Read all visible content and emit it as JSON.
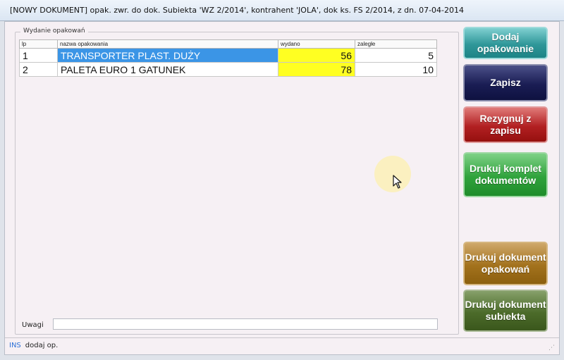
{
  "window": {
    "title": "[NOWY DOKUMENT] opak. zwr. do dok. Subiekta 'WZ 2/2014', kontrahent 'JOLA', dok ks. FS 2/2014, z dn. 07-04-2014"
  },
  "group": {
    "label": "Wydanie opakowań"
  },
  "table": {
    "columns": [
      "lp",
      "nazwa opakowania",
      "wydano",
      "zaległe"
    ],
    "rows": [
      {
        "lp": "1",
        "name": "TRANSPORTER PLAST. DUŻY",
        "issued": "56",
        "overdue": "5"
      },
      {
        "lp": "2",
        "name": "PALETA EURO 1 GATUNEK",
        "issued": "78",
        "overdue": "10"
      }
    ]
  },
  "buttons": {
    "add_packaging": "Dodaj opakowanie",
    "save": "Zapisz",
    "cancel_save": "Rezygnuj z zapisu",
    "print_all": "Drukuj komplet dokumentów",
    "print_packaging": "Drukuj dokument opakowań",
    "print_subiekt": "Drukuj dokument subiekta"
  },
  "notes": {
    "label": "Uwagi",
    "value": ""
  },
  "status": {
    "key": "INS",
    "text": "dodaj op."
  },
  "colors": {
    "selected_row": "#3b95e6",
    "highlight_cell": "#ffff22"
  },
  "icons": {
    "cursor": "mouse-pointer-icon",
    "grip": "resize-grip-icon"
  }
}
